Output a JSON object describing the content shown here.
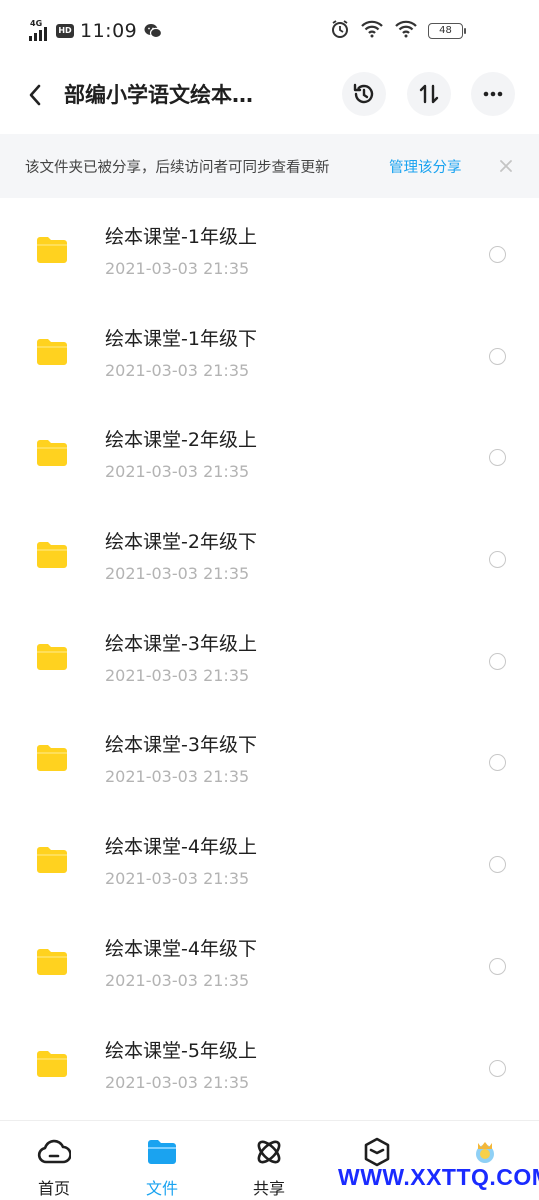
{
  "status_bar": {
    "network": "4G",
    "hd": "HD",
    "time": "11:09",
    "battery": "48"
  },
  "header": {
    "title": "部编小学语文绘本…"
  },
  "share_banner": {
    "text": "该文件夹已被分享，后续访问者可同步查看更新",
    "link": "管理该分享"
  },
  "files": [
    {
      "name": "绘本课堂-1年级上",
      "date": "2021-03-03  21:35"
    },
    {
      "name": "绘本课堂-1年级下",
      "date": "2021-03-03  21:35"
    },
    {
      "name": "绘本课堂-2年级上",
      "date": "2021-03-03  21:35"
    },
    {
      "name": "绘本课堂-2年级下",
      "date": "2021-03-03  21:35"
    },
    {
      "name": "绘本课堂-3年级上",
      "date": "2021-03-03  21:35"
    },
    {
      "name": "绘本课堂-3年级下",
      "date": "2021-03-03  21:35"
    },
    {
      "name": "绘本课堂-4年级上",
      "date": "2021-03-03  21:35"
    },
    {
      "name": "绘本课堂-4年级下",
      "date": "2021-03-03  21:35"
    },
    {
      "name": "绘本课堂-5年级上",
      "date": "2021-03-03  21:35"
    }
  ],
  "bottom_nav": {
    "items": [
      {
        "label": "首页",
        "icon": "cloud-icon"
      },
      {
        "label": "文件",
        "icon": "folder-icon",
        "active": true
      },
      {
        "label": "共享",
        "icon": "atom-icon"
      },
      {
        "label": "",
        "icon": "cube-icon"
      },
      {
        "label": "",
        "icon": "avatar-icon"
      }
    ]
  },
  "watermark": "WWW.XXTTQ.COM",
  "colors": {
    "accent": "#1aa3f0",
    "folder": "#ffd21f",
    "banner_bg": "#f5f6f8",
    "date_text": "#b3b3b3"
  }
}
